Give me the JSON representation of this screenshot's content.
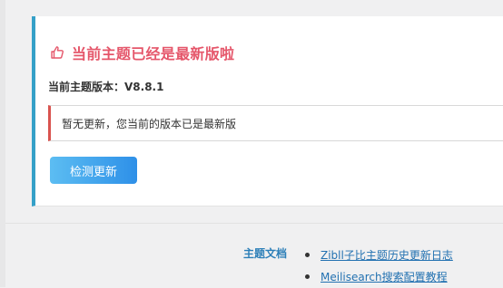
{
  "update_card": {
    "title": "当前主题已经是最新版啦",
    "version_label": "当前主题版本：",
    "version_value": "V8.8.1",
    "notice": "暂无更新，您当前的版本已是最新版",
    "check_button": "检测更新",
    "accent_color": "#e5566a",
    "border_color": "#35a0c8"
  },
  "footer": {
    "label": "主题文档",
    "links": [
      "Zibll子比主题历史更新日志",
      "Meilisearch搜索配置教程"
    ]
  }
}
